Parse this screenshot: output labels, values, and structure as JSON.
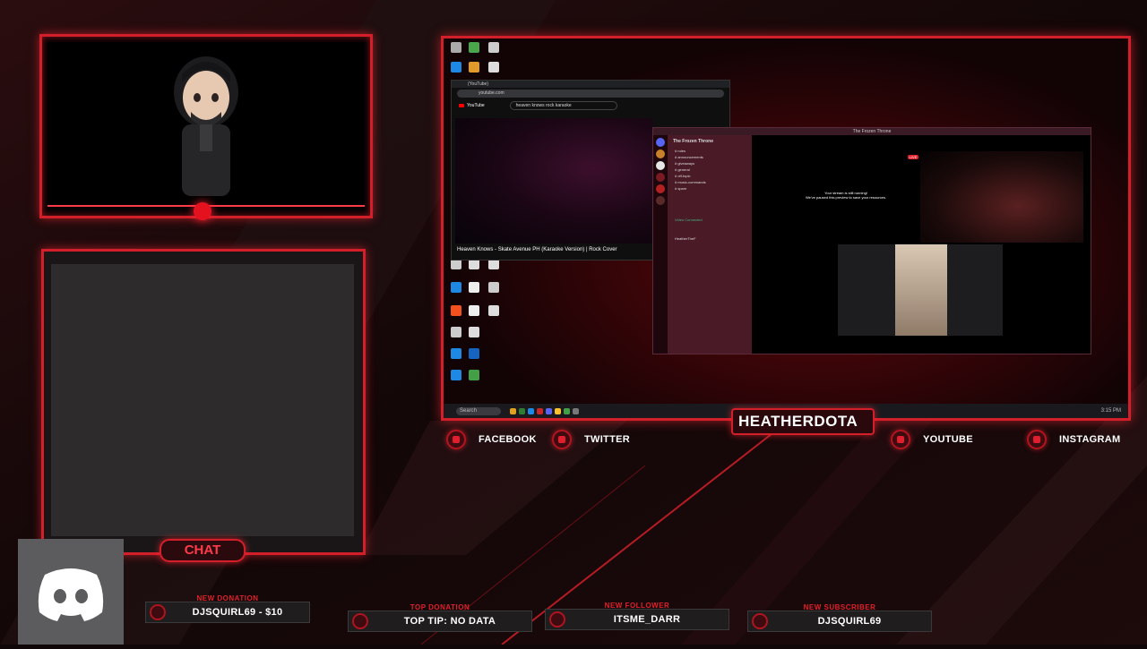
{
  "colors": {
    "accent": "#d21f2a",
    "glow": "#ff3b4a",
    "background": "#100708"
  },
  "chat": {
    "label": "CHAT"
  },
  "streamer": {
    "name": "HEATHERDOTA"
  },
  "socials": [
    {
      "label": "FACEBOOK",
      "icon": "facebook-icon"
    },
    {
      "label": "TWITTER",
      "icon": "twitter-icon"
    },
    {
      "label": "YOUTUBE",
      "icon": "youtube-icon"
    },
    {
      "label": "INSTAGRAM",
      "icon": "instagram-icon"
    }
  ],
  "alerts": [
    {
      "label": "NEW DONATION",
      "value": "DJSQUIRL69 - $10"
    },
    {
      "label": "TOP DONATION",
      "value": "TOP TIP: NO DATA"
    },
    {
      "label": "NEW FOLLOWER",
      "value": "ITSME_DARR"
    },
    {
      "label": "NEW SUBSCRIBER",
      "value": "DJSQUIRL69"
    }
  ],
  "browser": {
    "search_query": "heaven knows rock karaoke",
    "video_title": "Heaven Knows - Skate Avenue PH (Karaoke Version) | Rock Cover",
    "brand": "YouTube"
  },
  "discord_window": {
    "title": "The Frozen Throne",
    "server_name": "The Frozen Throne",
    "channels": [
      "# rules",
      "# announcements",
      "# giveaways",
      "# general",
      "# off-topic",
      "# music-commands",
      "# spam"
    ],
    "stream_msg_title": "Your stream is still running!",
    "stream_msg_body": "We've paused this preview to save your resources.",
    "live_badge": "LIVE",
    "voice_status": "Video Connected",
    "user_name": "HeatherTheF"
  },
  "taskbar": {
    "search": "Search",
    "time": "3:15 PM"
  }
}
